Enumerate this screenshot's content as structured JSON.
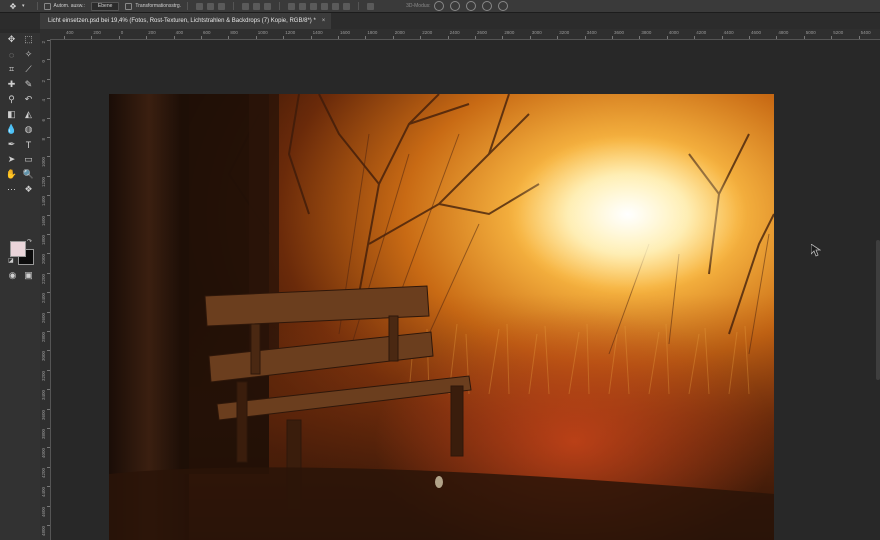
{
  "options_bar": {
    "auto_select_label": "Autom. ausw.:",
    "auto_select_target": "Ebene",
    "transform_label": "Transformationsstrg.",
    "mode_3d_label": "3D-Modus:"
  },
  "document": {
    "tab_title": "Licht einsetzen.psd bei 19,4% (Fotos, Rost-Texturen, Lichtstrahlen & Backdrops (7) Kopie, RGB/8*) *",
    "close_glyph": "×"
  },
  "toolbar": {
    "tools": [
      {
        "name": "move-icon",
        "glyph": "✥"
      },
      {
        "name": "marquee-icon",
        "glyph": "⬚"
      },
      {
        "name": "lasso-icon",
        "glyph": "◌"
      },
      {
        "name": "magic-wand-icon",
        "glyph": "✧"
      },
      {
        "name": "crop-icon",
        "glyph": "⌗"
      },
      {
        "name": "eyedropper-icon",
        "glyph": "⟋"
      },
      {
        "name": "healing-brush-icon",
        "glyph": "✚"
      },
      {
        "name": "brush-icon",
        "glyph": "✎"
      },
      {
        "name": "stamp-icon",
        "glyph": "⚲"
      },
      {
        "name": "history-brush-icon",
        "glyph": "↶"
      },
      {
        "name": "eraser-icon",
        "glyph": "◧"
      },
      {
        "name": "paint-bucket-icon",
        "glyph": "◭"
      },
      {
        "name": "blur-icon",
        "glyph": "💧"
      },
      {
        "name": "dodge-icon",
        "glyph": "◍"
      },
      {
        "name": "pen-icon",
        "glyph": "✒"
      },
      {
        "name": "type-icon",
        "glyph": "T"
      },
      {
        "name": "path-select-icon",
        "glyph": "➤"
      },
      {
        "name": "shape-icon",
        "glyph": "▭"
      },
      {
        "name": "hand-icon",
        "glyph": "✋"
      },
      {
        "name": "zoom-icon",
        "glyph": "🔍"
      },
      {
        "name": "edit-toolbar-icon",
        "glyph": "⋯"
      },
      {
        "name": "extra-icon",
        "glyph": "❖"
      }
    ],
    "quick_mask_glyph": "◉",
    "screen_mode_glyph": "▣"
  },
  "ruler_h": [
    "400",
    "200",
    "0",
    "200",
    "400",
    "600",
    "800",
    "1000",
    "1200",
    "1400",
    "1600",
    "1800",
    "2000",
    "2200",
    "2400",
    "2600",
    "2800",
    "3000",
    "3200",
    "3400",
    "3600",
    "3800",
    "4000",
    "4200",
    "4400",
    "4600",
    "4800",
    "5000",
    "5200",
    "5400",
    "5600",
    "5800",
    "6000"
  ],
  "ruler_v": [
    "2",
    "0",
    "2",
    "4",
    "6",
    "8",
    "1000",
    "1200",
    "1400",
    "1600",
    "1800",
    "2000",
    "2200",
    "2400",
    "2600",
    "2800",
    "3000",
    "3200",
    "3400",
    "3600",
    "3800",
    "4000",
    "4200",
    "4400",
    "4600",
    "4800"
  ],
  "colors": {
    "foreground": "#ead5da",
    "background": "#0c0c0c",
    "ui_dark": "#282828",
    "ui_panel": "#323232"
  }
}
